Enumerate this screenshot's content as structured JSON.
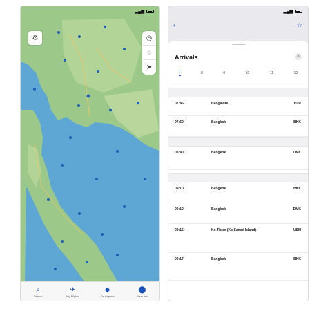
{
  "left_phone": {
    "status_time": "",
    "tabs": [
      {
        "label": "Search",
        "icon": "search-icon"
      },
      {
        "label": "My Flights",
        "icon": "plane-icon"
      },
      {
        "label": "On Airports",
        "icon": "airport-icon"
      },
      {
        "label": "Near me",
        "icon": "location-pin-icon"
      }
    ]
  },
  "right_phone": {
    "status_time": "",
    "title": "Arrivals",
    "hours": [
      "7",
      "8",
      "9",
      "10",
      "11",
      "12"
    ],
    "groups": [
      {
        "flights": [
          {
            "time": "07:45",
            "city": "Bangalore",
            "code": "BLR",
            "flights": "",
            "time2": ""
          },
          {
            "time": "07:50",
            "city": "Bangkok",
            "code": "BKK",
            "flights": "",
            "time2": ""
          }
        ]
      },
      {
        "flights": [
          {
            "time": "08:40",
            "city": "Bangkok",
            "code": "DMK",
            "flights": "",
            "time2": ""
          }
        ]
      },
      {
        "flights": [
          {
            "time": "09:10",
            "city": "Bangkok",
            "code": "BKK",
            "flights": "",
            "time2": ""
          },
          {
            "time": "09:10",
            "city": "Bangkok",
            "code": "DMK",
            "flights": "",
            "time2": ""
          },
          {
            "time": "09:15",
            "city": "Ko Thsm (Ko Samui Island)",
            "code": "USM",
            "flights": "",
            "time2": ""
          },
          {
            "time": "09:17",
            "city": "Bangkok",
            "code": "BKK",
            "flights": "",
            "time2": ""
          }
        ]
      }
    ]
  }
}
